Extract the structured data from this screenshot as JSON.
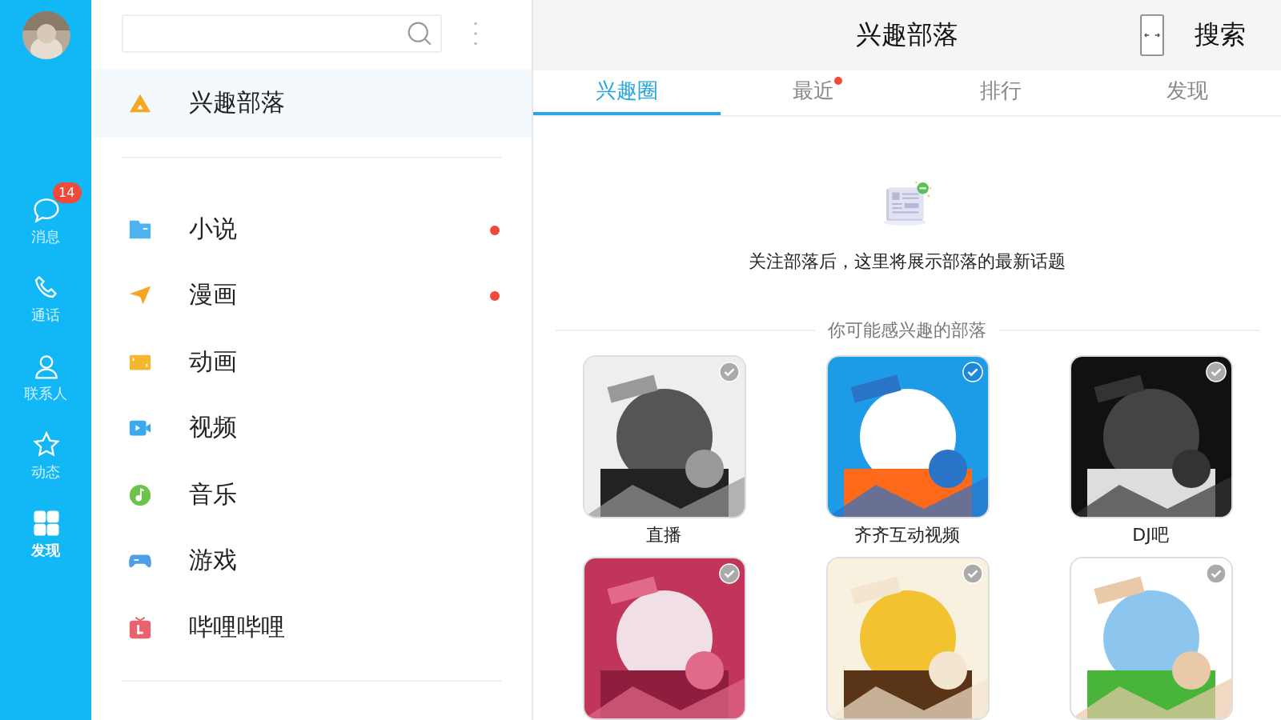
{
  "rail": {
    "items": [
      {
        "label": "消息",
        "badge": "14",
        "selected": false
      },
      {
        "label": "通话",
        "selected": false
      },
      {
        "label": "联系人",
        "selected": false
      },
      {
        "label": "动态",
        "selected": false
      },
      {
        "label": "发现",
        "selected": true
      }
    ]
  },
  "sidebar": {
    "featured": {
      "label": "兴趣部落",
      "selected": true
    },
    "items": [
      {
        "label": "小说",
        "dot": true,
        "selected": false
      },
      {
        "label": "漫画",
        "dot": true,
        "selected": false
      },
      {
        "label": "动画",
        "dot": false,
        "selected": false
      },
      {
        "label": "视频",
        "dot": false,
        "selected": false
      },
      {
        "label": "音乐",
        "dot": false,
        "selected": false
      },
      {
        "label": "游戏",
        "dot": false,
        "selected": false
      },
      {
        "label": "哔哩哔哩",
        "dot": false,
        "selected": false
      }
    ]
  },
  "header": {
    "title": "兴趣部落",
    "search_button": "搜索"
  },
  "tabs": [
    {
      "label": "兴趣圈",
      "selected": true,
      "dot": false
    },
    {
      "label": "最近",
      "selected": false,
      "dot": true
    },
    {
      "label": "排行",
      "selected": false,
      "dot": false
    },
    {
      "label": "发现",
      "selected": false,
      "dot": false
    }
  ],
  "empty_message": "关注部落后，这里将展示部落的最新话题",
  "suggestions": {
    "heading": "你可能感兴趣的部落",
    "tribes": [
      {
        "name": "直播",
        "checked": false
      },
      {
        "name": "齐齐互动视频",
        "checked": true
      },
      {
        "name": "DJ吧",
        "checked": false
      },
      {
        "checked": false
      },
      {
        "checked": false
      },
      {
        "checked": false
      }
    ]
  }
}
